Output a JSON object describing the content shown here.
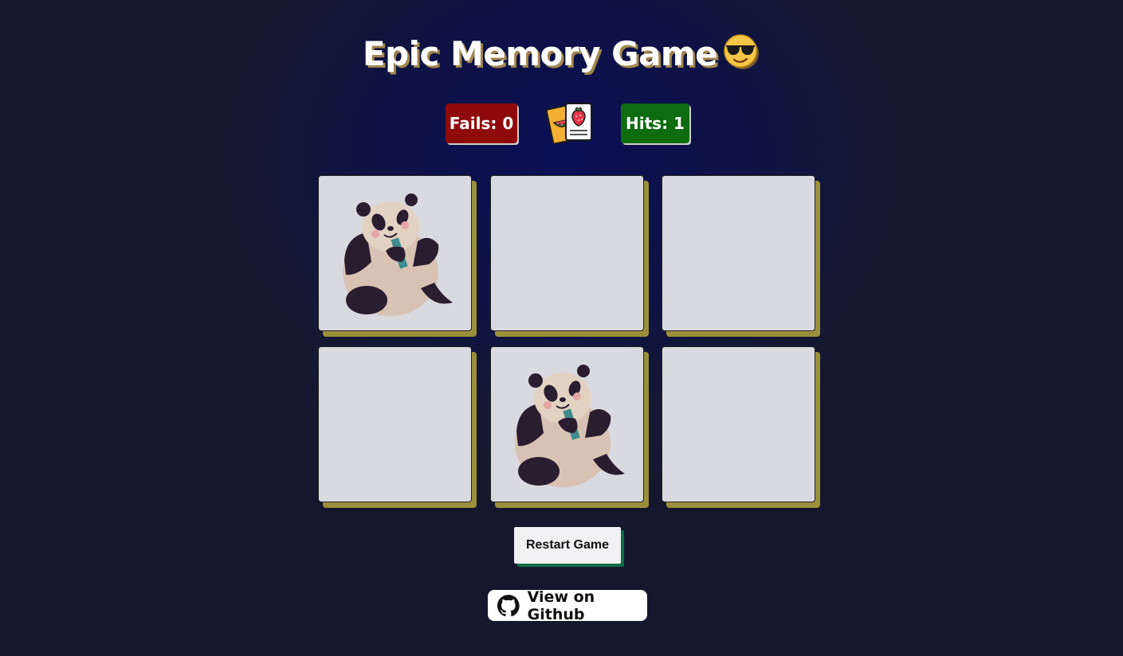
{
  "header": {
    "title": "Epic Memory Game",
    "title_emoji": "smiling-face-with-sunglasses-icon"
  },
  "score": {
    "fails_label": "Fails: 0",
    "hits_label": "Hits: 1",
    "fails": 0,
    "hits": 1,
    "logo_icon": "fruit-cards-icon"
  },
  "board": {
    "rows": 2,
    "columns": 3,
    "cards": [
      {
        "state": "revealed",
        "image": "panda-icon"
      },
      {
        "state": "hidden",
        "image": ""
      },
      {
        "state": "hidden",
        "image": ""
      },
      {
        "state": "hidden",
        "image": ""
      },
      {
        "state": "revealed",
        "image": "panda-icon"
      },
      {
        "state": "hidden",
        "image": ""
      }
    ]
  },
  "actions": {
    "restart_label": "Restart Game",
    "github_label": "View on Github"
  },
  "colors": {
    "fails": "#8f0b0b",
    "hits": "#0d6b10",
    "card_face": "#d9d9e0",
    "card_shadow": "#9c8f3b",
    "restart_shadow": "#0e6b45",
    "title_shadow": "#a1874f"
  }
}
